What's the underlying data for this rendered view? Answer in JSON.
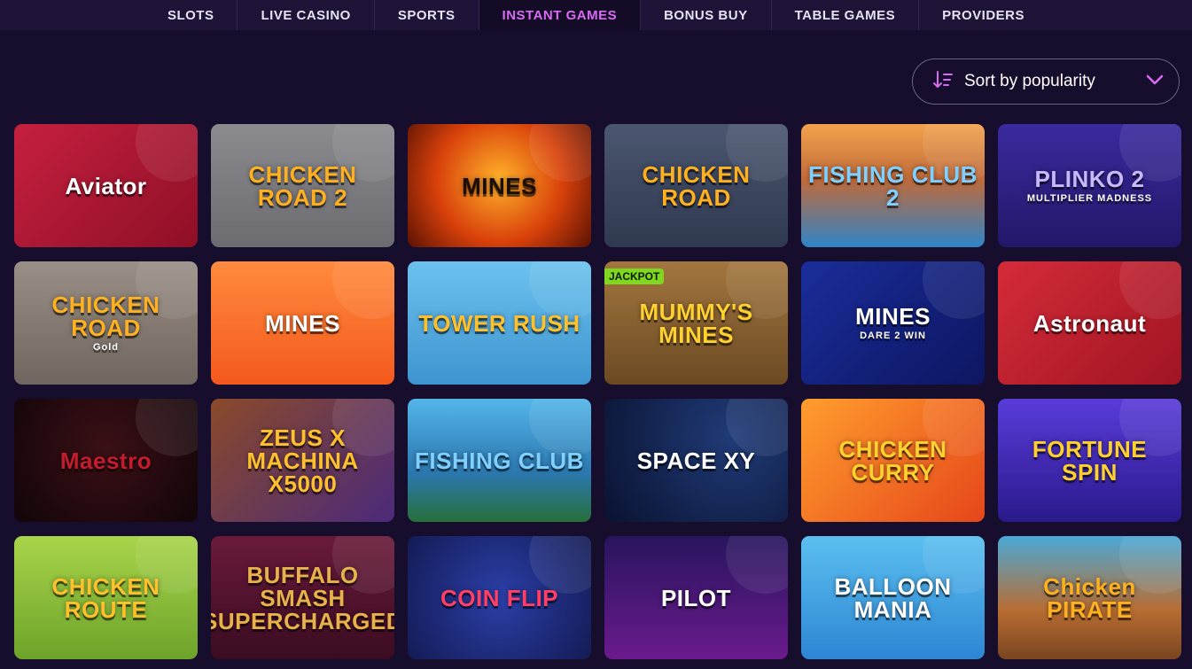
{
  "nav": {
    "tabs": [
      {
        "label": "SLOTS",
        "active": false
      },
      {
        "label": "LIVE CASINO",
        "active": false
      },
      {
        "label": "SPORTS",
        "active": false
      },
      {
        "label": "INSTANT GAMES",
        "active": true
      },
      {
        "label": "BONUS BUY",
        "active": false
      },
      {
        "label": "TABLE GAMES",
        "active": false
      },
      {
        "label": "PROVIDERS",
        "active": false
      }
    ]
  },
  "sort": {
    "label": "Sort by popularity",
    "icon": "sort-icon",
    "chevron": "chevron-down-icon"
  },
  "colors": {
    "accent": "#d96bf5",
    "background": "#170d2c",
    "nav_background": "#1f1338",
    "jackpot": "#7fd81f"
  },
  "games": [
    {
      "title": "Aviator",
      "bg": "linear-gradient(135deg,#c5203f,#8f0f26)",
      "color": "#ffffff"
    },
    {
      "title": "CHICKEN ROAD 2",
      "bg": "linear-gradient(180deg,#8b8b8f,#6b6b70)",
      "color": "#ffb01f"
    },
    {
      "title": "MINES",
      "bg": "radial-gradient(circle at 50% 45%,#ffb22a,#d9410b 55%,#5a1203)",
      "color": "#1a0e06"
    },
    {
      "title": "CHICKEN ROAD",
      "bg": "linear-gradient(180deg,#4b5670,#2f3950)",
      "color": "#ffb01f"
    },
    {
      "title": "FISHING CLUB 2",
      "bg": "linear-gradient(180deg,#f3a34d,#c06a3a 45%,#2f84c8)",
      "color": "#7fd0ff"
    },
    {
      "title": "PLINKO 2",
      "subtitle": "MULTIPLIER MADNESS",
      "bg": "linear-gradient(180deg,#3b2a9e,#221769)",
      "color": "#c8b8ff"
    },
    {
      "title": "CHICKEN ROAD",
      "subtitle": "Gold",
      "bg": "linear-gradient(180deg,#9a8f86,#6f665f)",
      "color": "#ffb01f"
    },
    {
      "title": "MINES",
      "bg": "linear-gradient(180deg,#ff8a3d,#f4591c)",
      "color": "#ffffff"
    },
    {
      "title": "TOWER RUSH",
      "bg": "linear-gradient(180deg,#6cc2ee,#3e94cf)",
      "color": "#ffc12b"
    },
    {
      "title": "MUMMY'S MINES",
      "badge": "JACKPOT",
      "bg": "linear-gradient(180deg,#a3763f,#6b4a23)",
      "color": "#ffd12e"
    },
    {
      "title": "MINES",
      "subtitle": "DARE 2 WIN",
      "bg": "linear-gradient(135deg,#1a2d9a,#0d1660)",
      "color": "#ffffff"
    },
    {
      "title": "Astronaut",
      "bg": "linear-gradient(135deg,#d52b3a,#a01522)",
      "color": "#ffffff"
    },
    {
      "title": "Maestro",
      "bg": "radial-gradient(circle at 50% 40%,#3a1016,#120508)",
      "color": "#c41c2c"
    },
    {
      "title": "ZEUS X MACHINA X5000",
      "bg": "linear-gradient(135deg,#8a4a2a,#4b2a7a)",
      "color": "#ffc12b"
    },
    {
      "title": "FISHING CLUB",
      "bg": "linear-gradient(180deg,#53b5e8,#2b78b0 60%,#276f3a)",
      "color": "#7fd0ff"
    },
    {
      "title": "SPACE XY",
      "bg": "radial-gradient(circle at 70% 30%,#203b78,#0a1230)",
      "color": "#ffffff"
    },
    {
      "title": "CHICKEN CURRY",
      "bg": "linear-gradient(135deg,#ff9d2e,#e6461a)",
      "color": "#ffd12e"
    },
    {
      "title": "FORTUNE SPIN",
      "bg": "linear-gradient(180deg,#5a3bd9,#2a1a8c)",
      "color": "#ffd12e"
    },
    {
      "title": "CHICKEN ROUTE",
      "bg": "linear-gradient(180deg,#a8d44a,#6da32a)",
      "color": "#ffc12b"
    },
    {
      "title": "BUFFALO SMASH SUPERCHARGED",
      "bg": "linear-gradient(180deg,#6a1a3a,#3a0c22)",
      "color": "#e8b24a"
    },
    {
      "title": "COIN FLIP",
      "bg": "radial-gradient(circle at 50% 50%,#2b3fa8,#141b55)",
      "color": "#ff3f66"
    },
    {
      "title": "PILOT",
      "bg": "linear-gradient(180deg,#28155e,#6a1a8c)",
      "color": "#ffffff"
    },
    {
      "title": "BALLOON MANIA",
      "bg": "linear-gradient(180deg,#5bbff0,#2e86d4)",
      "color": "#ffffff"
    },
    {
      "title": "Chicken PIRATE",
      "bg": "linear-gradient(180deg,#4aa9d8,#b86d32 60%,#7a4520)",
      "color": "#ffb01f"
    }
  ]
}
